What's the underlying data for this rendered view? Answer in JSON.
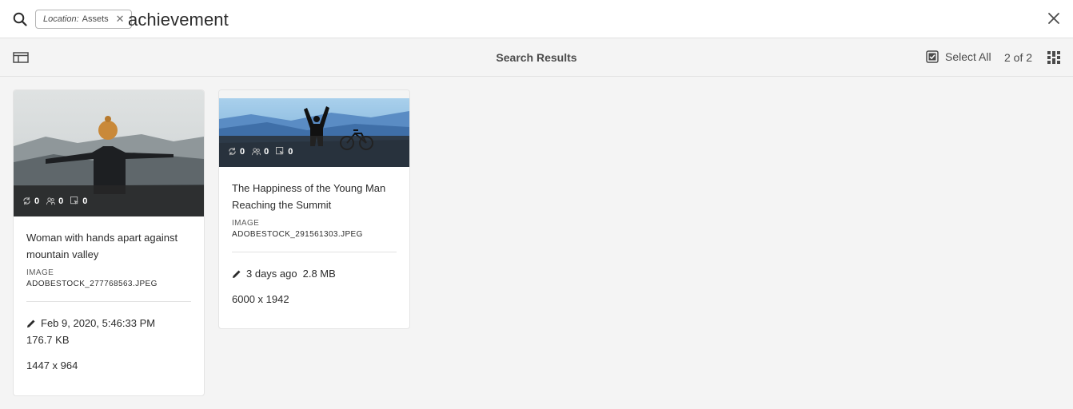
{
  "search": {
    "tag_key": "Location:",
    "tag_value": "Assets",
    "query": "achievement"
  },
  "toolbar": {
    "title": "Search Results",
    "select_all_label": "Select All",
    "count": "2 of 2"
  },
  "icons": {
    "search": "search-icon",
    "close": "close-icon",
    "rail": "rail-toggle-icon",
    "select_all": "checkbox-icon",
    "view": "grid-view-icon",
    "edit": "pencil-icon"
  },
  "results": [
    {
      "title": "Woman with hands apart against mountain valley",
      "type": "IMAGE",
      "filename": "ADOBESTOCK_277768563.JPEG",
      "modified": "Feb 9, 2020, 5:46:33 PM",
      "size": "176.7 KB",
      "dimensions": "1447 x 964",
      "stats": [
        "0",
        "0",
        "0"
      ]
    },
    {
      "title": "The Happiness of the Young Man Reaching the Summit",
      "type": "IMAGE",
      "filename": "ADOBESTOCK_291561303.JPEG",
      "modified": "3 days ago",
      "size": "2.8 MB",
      "dimensions": "6000 x 1942",
      "stats": [
        "0",
        "0",
        "0"
      ]
    }
  ]
}
